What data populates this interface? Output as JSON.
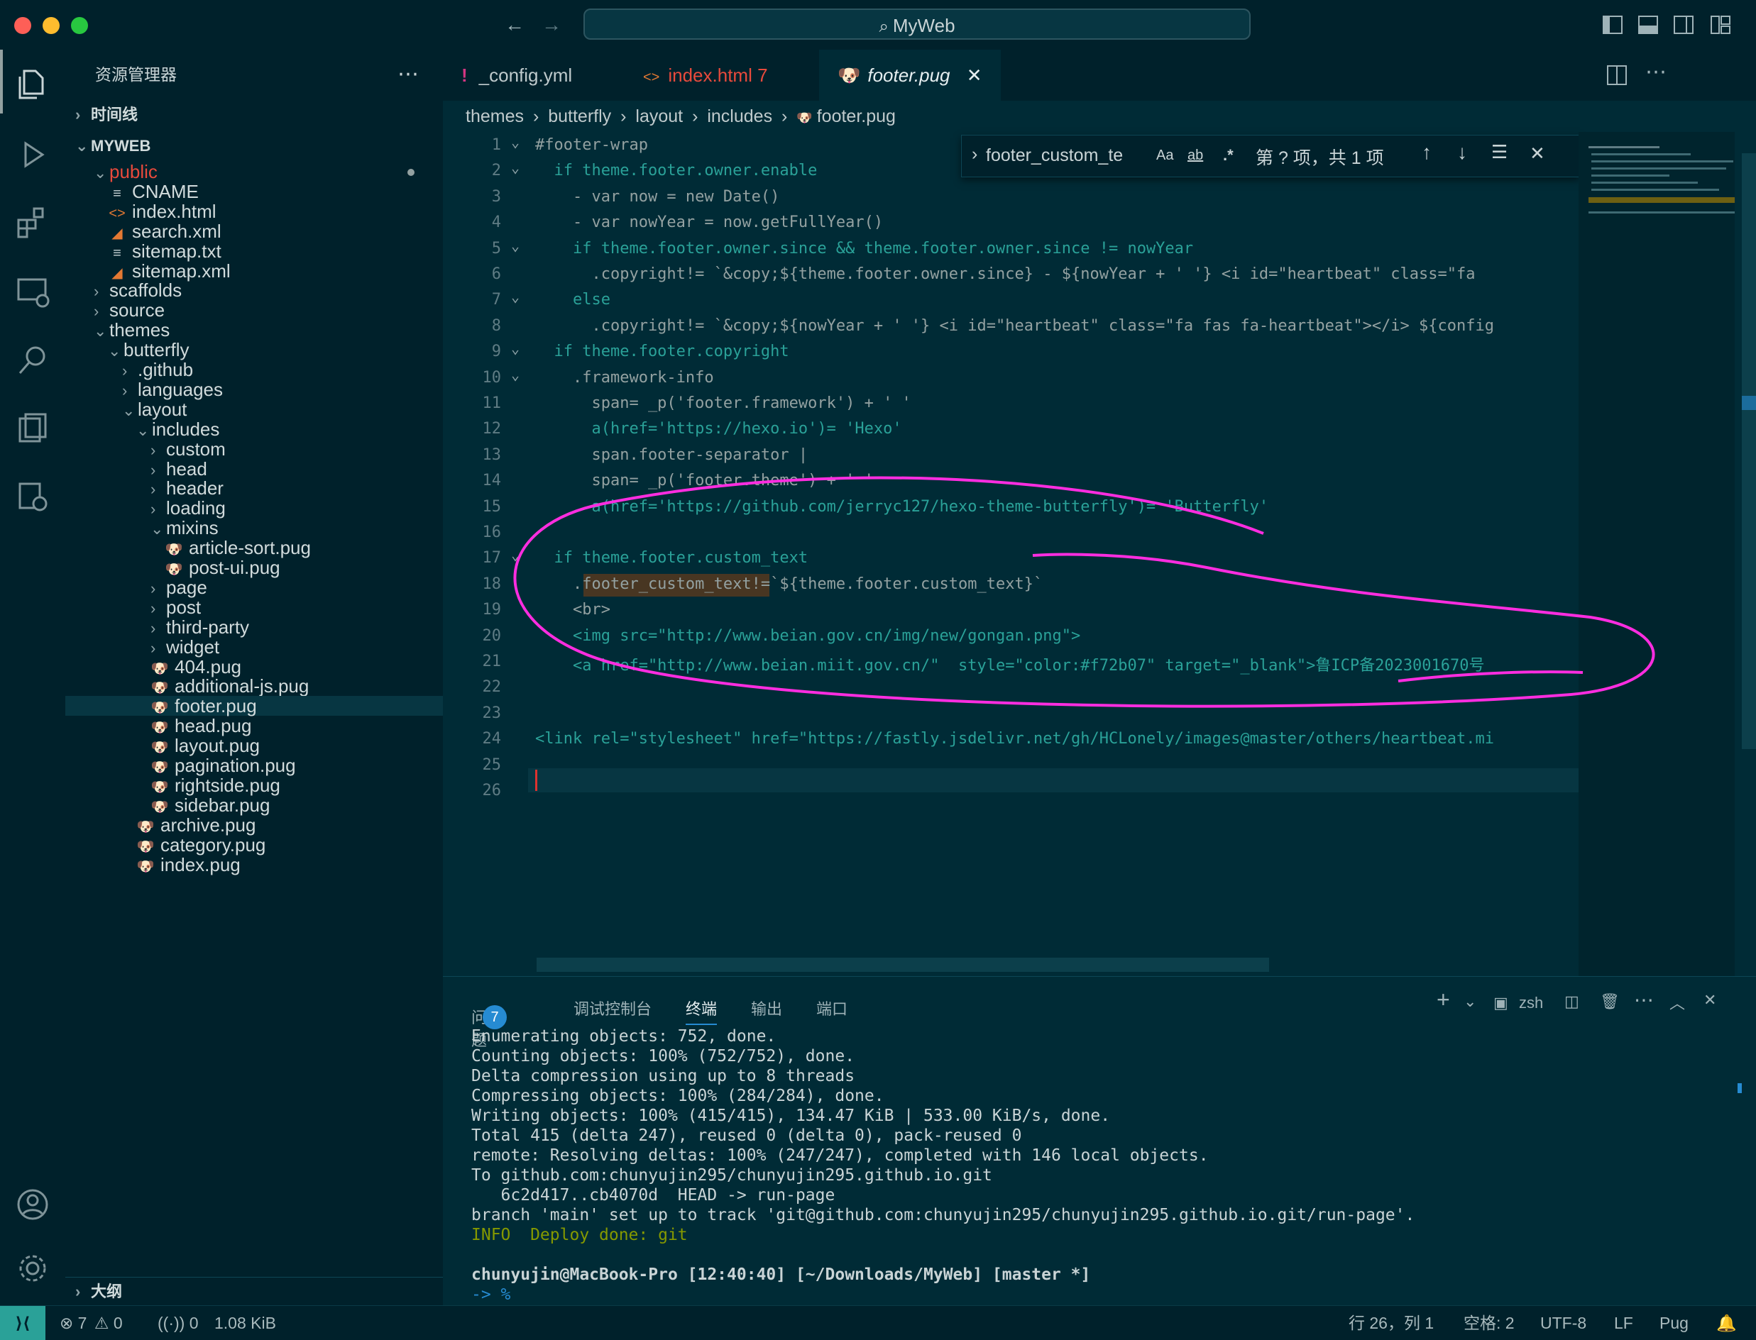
{
  "window": {
    "title": "MyWeb"
  },
  "explorer": {
    "title": "资源管理器",
    "sections": {
      "timeline": "时间线",
      "project": "MYWEB",
      "outline": "大纲"
    },
    "tree": [
      {
        "label": "public",
        "depth": 1,
        "kind": "folder-open",
        "special": "public"
      },
      {
        "label": "CNAME",
        "depth": 2,
        "kind": "text"
      },
      {
        "label": "index.html",
        "depth": 2,
        "kind": "html"
      },
      {
        "label": "search.xml",
        "depth": 2,
        "kind": "rss"
      },
      {
        "label": "sitemap.txt",
        "depth": 2,
        "kind": "text"
      },
      {
        "label": "sitemap.xml",
        "depth": 2,
        "kind": "rss"
      },
      {
        "label": "scaffolds",
        "depth": 1,
        "kind": "folder"
      },
      {
        "label": "source",
        "depth": 1,
        "kind": "folder"
      },
      {
        "label": "themes",
        "depth": 1,
        "kind": "folder-open"
      },
      {
        "label": "butterfly",
        "depth": 2,
        "kind": "folder-open"
      },
      {
        "label": ".github",
        "depth": 3,
        "kind": "folder"
      },
      {
        "label": "languages",
        "depth": 3,
        "kind": "folder"
      },
      {
        "label": "layout",
        "depth": 3,
        "kind": "folder-open"
      },
      {
        "label": "includes",
        "depth": 4,
        "kind": "folder-open"
      },
      {
        "label": "custom",
        "depth": 5,
        "kind": "folder"
      },
      {
        "label": "head",
        "depth": 5,
        "kind": "folder"
      },
      {
        "label": "header",
        "depth": 5,
        "kind": "folder"
      },
      {
        "label": "loading",
        "depth": 5,
        "kind": "folder"
      },
      {
        "label": "mixins",
        "depth": 5,
        "kind": "folder-open"
      },
      {
        "label": "article-sort.pug",
        "depth": 6,
        "kind": "pug"
      },
      {
        "label": "post-ui.pug",
        "depth": 6,
        "kind": "pug"
      },
      {
        "label": "page",
        "depth": 5,
        "kind": "folder"
      },
      {
        "label": "post",
        "depth": 5,
        "kind": "folder"
      },
      {
        "label": "third-party",
        "depth": 5,
        "kind": "folder"
      },
      {
        "label": "widget",
        "depth": 5,
        "kind": "folder"
      },
      {
        "label": "404.pug",
        "depth": 5,
        "kind": "pug"
      },
      {
        "label": "additional-js.pug",
        "depth": 5,
        "kind": "pug"
      },
      {
        "label": "footer.pug",
        "depth": 5,
        "kind": "pug",
        "selected": true
      },
      {
        "label": "head.pug",
        "depth": 5,
        "kind": "pug"
      },
      {
        "label": "layout.pug",
        "depth": 5,
        "kind": "pug"
      },
      {
        "label": "pagination.pug",
        "depth": 5,
        "kind": "pug"
      },
      {
        "label": "rightside.pug",
        "depth": 5,
        "kind": "pug"
      },
      {
        "label": "sidebar.pug",
        "depth": 5,
        "kind": "pug"
      },
      {
        "label": "archive.pug",
        "depth": 4,
        "kind": "pug"
      },
      {
        "label": "category.pug",
        "depth": 4,
        "kind": "pug"
      },
      {
        "label": "index.pug",
        "depth": 4,
        "kind": "pug"
      }
    ]
  },
  "tabs": [
    {
      "label": "_config.yml",
      "icon": "!"
    },
    {
      "label": "index.html",
      "badge": "7",
      "icon": "<>"
    },
    {
      "label": "footer.pug",
      "active": true
    }
  ],
  "breadcrumb": [
    "themes",
    "butterfly",
    "layout",
    "includes",
    "footer.pug"
  ],
  "find": {
    "query": "footer_custom_te",
    "result": "第 ? 项，共 1 项",
    "aa": "Aa",
    "ab": "ab",
    "regex": ".*"
  },
  "code": {
    "lines": [
      "#footer-wrap",
      "  if theme.footer.owner.enable",
      "    - var now = new Date()",
      "    - var nowYear = now.getFullYear()",
      "    if theme.footer.owner.since && theme.footer.owner.since != nowYear",
      "      .copyright!= `&copy;${theme.footer.owner.since} - ${nowYear + ' '} <i id=\"heartbeat\" class=\"fa",
      "    else",
      "      .copyright!= `&copy;${nowYear + ' '} <i id=\"heartbeat\" class=\"fa fas fa-heartbeat\"></i> ${config",
      "  if theme.footer.copyright",
      "    .framework-info",
      "      span= _p('footer.framework') + ' '",
      "      a(href='https://hexo.io')= 'Hexo'",
      "      span.footer-separator |",
      "      span= _p('footer.theme') + ' '",
      "      a(href='https://github.com/jerryc127/hexo-theme-butterfly')= 'Butterfly'",
      "",
      "  if theme.footer.custom_text",
      "    .footer_custom_text!=`${theme.footer.custom_text}`",
      "    <br>",
      "    <img src=\"http://www.beian.gov.cn/img/new/gongan.png\">",
      "    <a href=\"http://www.beian.miit.gov.cn/\"  style=\"color:#f72b07\" target=\"_blank\">鲁ICP备2023001670号",
      "",
      "",
      "<link rel=\"stylesheet\" href=\"https://fastly.jsdelivr.net/gh/HCLonely/images@master/others/heartbeat.mi",
      "",
      ""
    ]
  },
  "panel": {
    "tabs": [
      {
        "label": "问题",
        "badge": "7"
      },
      {
        "label": "调试控制台"
      },
      {
        "label": "终端",
        "active": true
      },
      {
        "label": "输出"
      },
      {
        "label": "端口"
      }
    ],
    "shell": "zsh",
    "terminal": [
      "Enumerating objects: 752, done.",
      "Counting objects: 100% (752/752), done.",
      "Delta compression using up to 8 threads",
      "Compressing objects: 100% (284/284), done.",
      "Writing objects: 100% (415/415), 134.47 KiB | 533.00 KiB/s, done.",
      "Total 415 (delta 247), reused 0 (delta 0), pack-reused 0",
      "remote: Resolving deltas: 100% (247/247), completed with 146 local objects.",
      "To github.com:chunyujin295/chunyujin295.github.io.git",
      "   6c2d417..cb4070d  HEAD -> run-page",
      "branch 'main' set up to track 'git@github.com:chunyujin295/chunyujin295.github.io.git/run-page'.",
      "INFO  Deploy done: git",
      "",
      "chunyujin@MacBook-Pro [12:40:40] [~/Downloads/MyWeb] [master *]",
      "-> % "
    ]
  },
  "status": {
    "errors": "7",
    "warnings": "0",
    "ports": "0",
    "size": "1.08 KiB",
    "position": "行 26，列 1",
    "spaces": "空格: 2",
    "encoding": "UTF-8",
    "eol": "LF",
    "language": "Pug"
  },
  "colors": {
    "accent": "#268bd2",
    "annotation": "#ff2de0",
    "modified": "#e84a3c"
  }
}
